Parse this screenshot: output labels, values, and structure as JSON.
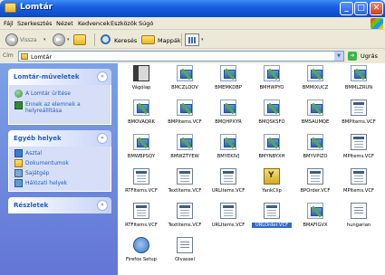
{
  "window": {
    "title": "Lomtár"
  },
  "menu": [
    "Fájl",
    "Szerkesztés",
    "Nézet",
    "Kedvencek",
    "Eszközök",
    "Súgó"
  ],
  "toolbar": {
    "back_label": "Vissza",
    "search_label": "Keresés",
    "folders_label": "Mappák"
  },
  "address": {
    "label": "Cím",
    "value": "Lomtár",
    "go_label": "Ugrás"
  },
  "tasks": {
    "recycle": {
      "title": "Lomtár-műveletek",
      "items": [
        "A Lomtár ürítése",
        "Ennek az elemnek a helyreállítása"
      ]
    },
    "other": {
      "title": "Egyéb helyek",
      "items": [
        "Asztal",
        "Dokumentumok",
        "Sajátgép",
        "Hálózati helyek"
      ]
    },
    "details": {
      "title": "Részletek"
    }
  },
  "files": [
    {
      "name": "Vágólap",
      "type": "book"
    },
    {
      "name": "BMCZLQOV",
      "type": "app"
    },
    {
      "name": "BMEMKDBP",
      "type": "app"
    },
    {
      "name": "BMHWPYO",
      "type": "app"
    },
    {
      "name": "BMMIXUCZ",
      "type": "app"
    },
    {
      "name": "BMMLZRUN",
      "type": "app"
    },
    {
      "name": "BMOVAQRK",
      "type": "app"
    },
    {
      "name": "BMPItems.VCF",
      "type": "app"
    },
    {
      "name": "BMQHPXYR",
      "type": "app"
    },
    {
      "name": "BMQSKSFO",
      "type": "app"
    },
    {
      "name": "BMSAUMQE",
      "type": "app"
    },
    {
      "name": "BMPItems.VCF",
      "type": "vcf"
    },
    {
      "name": "BMWBPSQY",
      "type": "app"
    },
    {
      "name": "BMWZTYEW",
      "type": "app"
    },
    {
      "name": "BMYEKIVJ",
      "type": "app"
    },
    {
      "name": "BMYNBYXH",
      "type": "app"
    },
    {
      "name": "BMYVPIZO",
      "type": "app"
    },
    {
      "name": "MPItems.VCF",
      "type": "vcf"
    },
    {
      "name": "RTFItems.VCF",
      "type": "vcf"
    },
    {
      "name": "TextItems.VCF",
      "type": "vcf"
    },
    {
      "name": "URLItems.VCF",
      "type": "vcf"
    },
    {
      "name": "YankClip",
      "type": "yank"
    },
    {
      "name": "BPOrder.VCF",
      "type": "vcf"
    },
    {
      "name": "MPItems.VCF",
      "type": "vcf"
    },
    {
      "name": "RTFItems.VCF",
      "type": "vcf"
    },
    {
      "name": "TextItems.VCF",
      "type": "vcf"
    },
    {
      "name": "URLItems.VCF",
      "type": "vcf"
    },
    {
      "name": "URLOrder.VCF",
      "type": "vcf",
      "selected": true
    },
    {
      "name": "BMAFIGVX",
      "type": "app"
    },
    {
      "name": "hungarian",
      "type": "txt"
    },
    {
      "name": "Firefox Setup",
      "type": "inst"
    },
    {
      "name": "Olvassel",
      "type": "txt"
    }
  ]
}
